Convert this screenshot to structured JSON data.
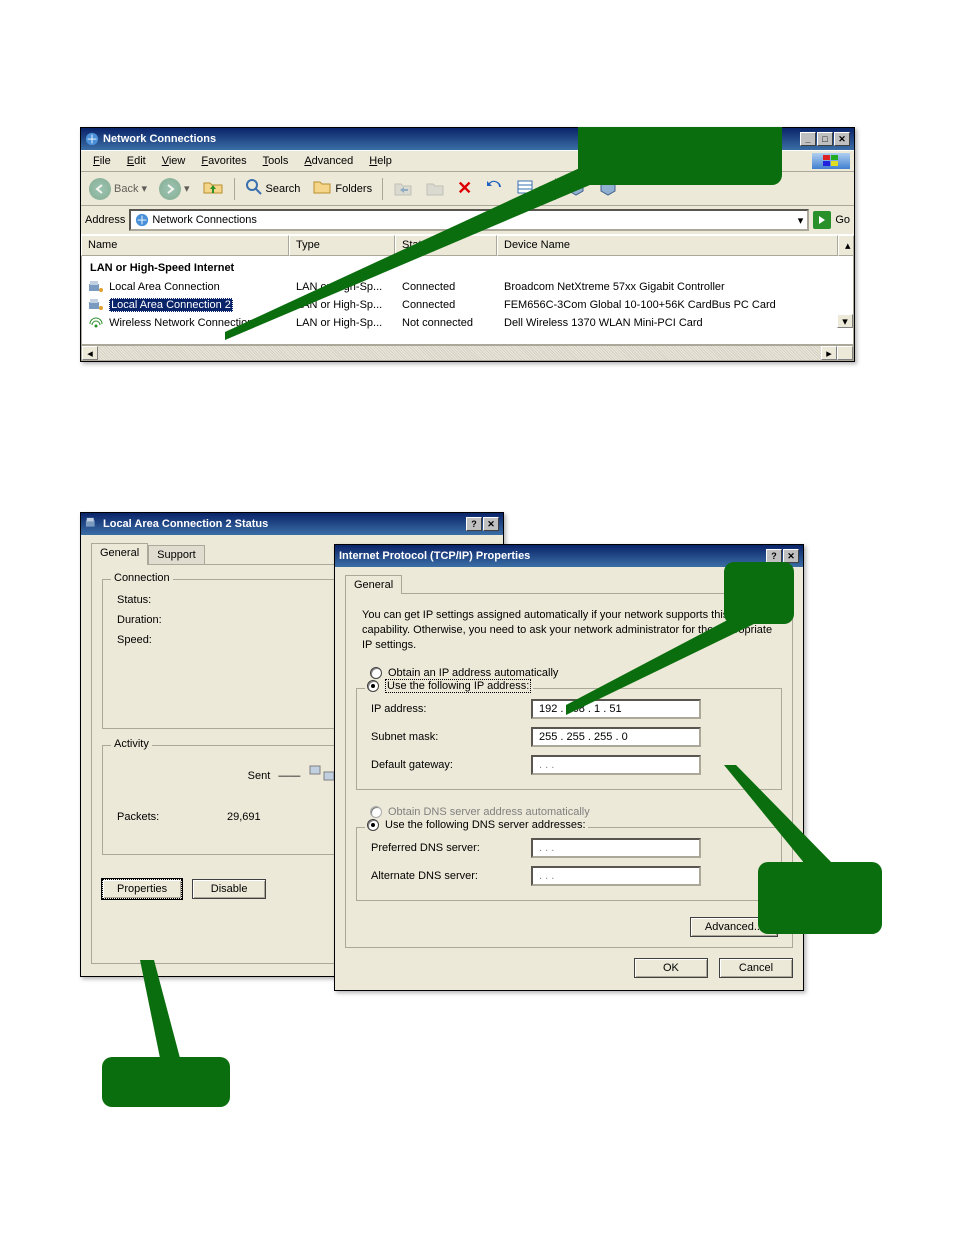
{
  "netconn": {
    "title": "Network Connections",
    "menu": [
      "File",
      "Edit",
      "View",
      "Favorites",
      "Tools",
      "Advanced",
      "Help"
    ],
    "toolbar": {
      "back": "Back",
      "search": "Search",
      "folders": "Folders"
    },
    "address_label": "Address",
    "address_value": "Network Connections",
    "go": "Go",
    "columns": {
      "name": "Name",
      "type": "Type",
      "status": "Status",
      "device": "Device Name"
    },
    "group": "LAN or High-Speed Internet",
    "rows": [
      {
        "name": "Local Area Connection",
        "type": "LAN or High-Sp...",
        "status": "Connected",
        "device": "Broadcom NetXtreme 57xx Gigabit Controller",
        "selected": false,
        "icon": "net"
      },
      {
        "name": "Local Area Connection 2",
        "type": "LAN or High-Sp...",
        "status": "Connected",
        "device": "FEM656C-3Com Global 10-100+56K CardBus PC Card",
        "selected": true,
        "icon": "net"
      },
      {
        "name": "Wireless Network Connection",
        "type": "LAN or High-Sp...",
        "status": "Not connected",
        "device": "Dell Wireless 1370 WLAN Mini-PCI Card",
        "selected": false,
        "icon": "wifi"
      }
    ]
  },
  "status": {
    "title": "Local Area Connection 2 Status",
    "tabs": {
      "general": "General",
      "support": "Support"
    },
    "connection": {
      "title": "Connection",
      "status_l": "Status:",
      "status_v": "",
      "duration_l": "Duration:",
      "duration_v": "",
      "speed_l": "Speed:",
      "speed_v": ""
    },
    "activity": {
      "title": "Activity",
      "sent": "Sent",
      "packets_l": "Packets:",
      "packets_v": "29,691"
    },
    "buttons": {
      "properties": "Properties",
      "disable": "Disable"
    }
  },
  "tcpip": {
    "title": "Internet Protocol (TCP/IP) Properties",
    "tab": "General",
    "desc": "You can get IP settings assigned automatically if your network supports this capability. Otherwise, you need to ask your network administrator for the appropriate IP settings.",
    "obtain_ip": "Obtain an IP address automatically",
    "use_ip": "Use the following IP address:",
    "ip_l": "IP address:",
    "ip_v": "192 . 168 .  1  .  51",
    "mask_l": "Subnet mask:",
    "mask_v": "255 . 255 . 255 .  0",
    "gw_l": "Default gateway:",
    "gw_v": ".       .       .",
    "obtain_dns": "Obtain DNS server address automatically",
    "use_dns": "Use the following DNS server addresses:",
    "pdns_l": "Preferred DNS server:",
    "pdns_v": ".       .       .",
    "adns_l": "Alternate DNS server:",
    "adns_v": ".       .       .",
    "advanced": "Advanced...",
    "ok": "OK",
    "cancel": "Cancel"
  }
}
